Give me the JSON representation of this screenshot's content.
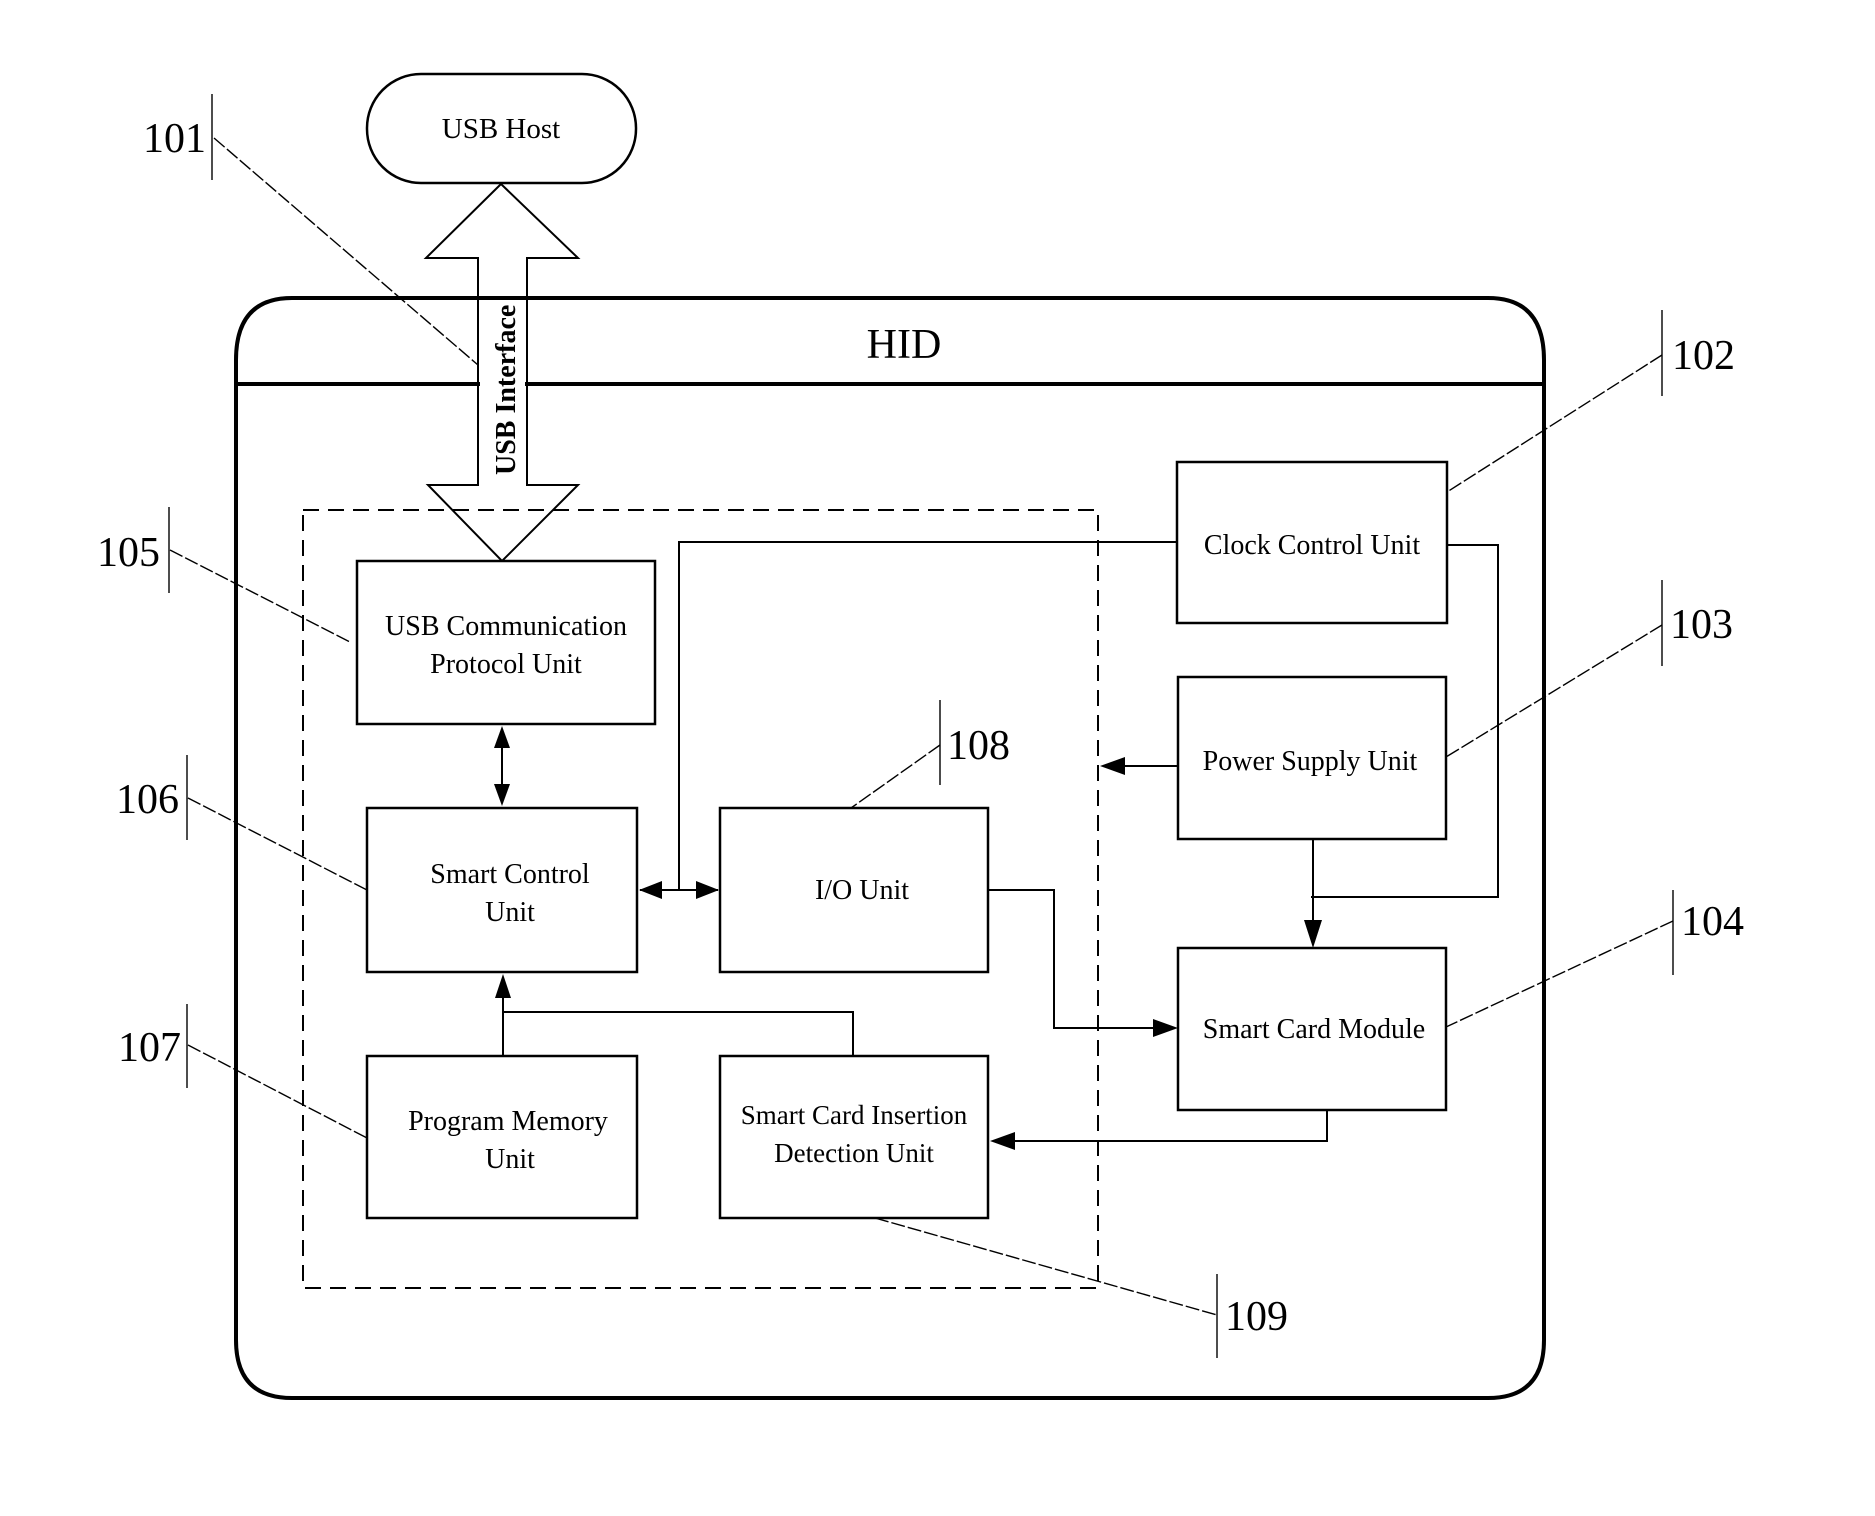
{
  "diagram": {
    "usb_host": "USB Host",
    "usb_interface": "USB Interface",
    "container_title": "HID",
    "blocks": {
      "usb_comm_line1": "USB Communication",
      "usb_comm_line2": "Protocol Unit",
      "smart_control_line1": "Smart Control",
      "smart_control_line2": "Unit",
      "io_unit": "I/O Unit",
      "program_memory_line1": "Program Memory",
      "program_memory_line2": "Unit",
      "insertion_line1": "Smart Card Insertion",
      "insertion_line2": "Detection Unit",
      "clock_control": "Clock Control Unit",
      "power_supply": "Power Supply Unit",
      "smart_card_module": "Smart Card Module"
    },
    "refs": {
      "r101": "101",
      "r102": "102",
      "r103": "103",
      "r104": "104",
      "r105": "105",
      "r106": "106",
      "r107": "107",
      "r108": "108",
      "r109": "109"
    }
  }
}
